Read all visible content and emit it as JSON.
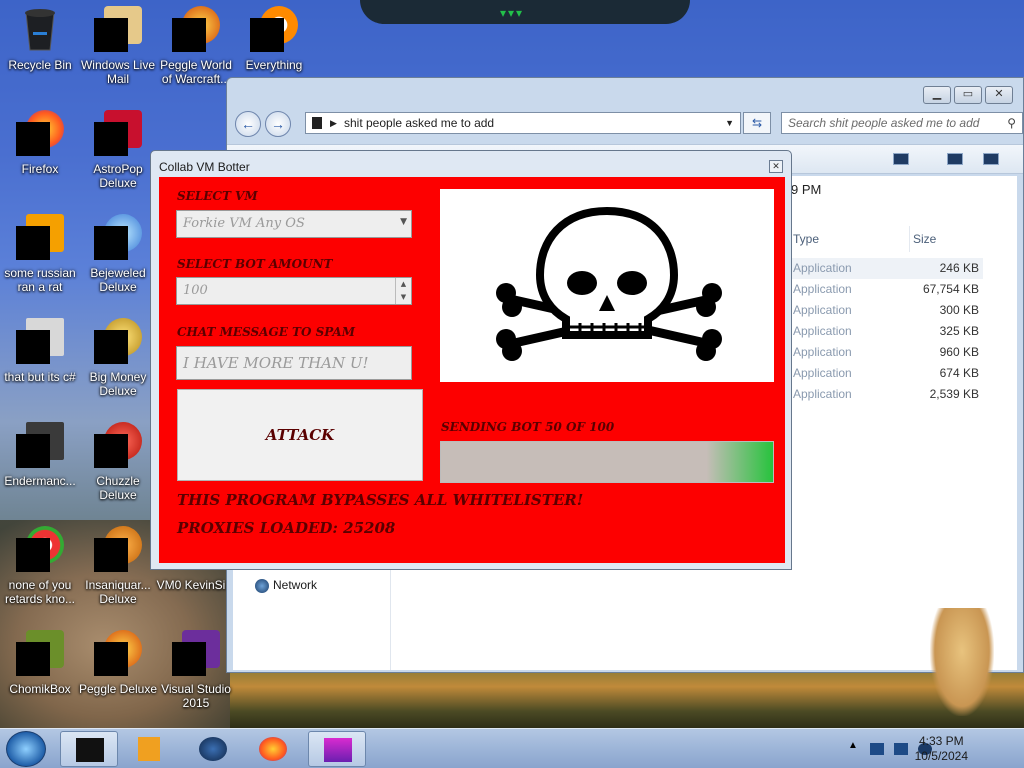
{
  "desktop": {
    "icons": [
      {
        "label": "Recycle Bin"
      },
      {
        "label": "Windows Live Mail"
      },
      {
        "label": "Peggle World of Warcraft..."
      },
      {
        "label": "Everything"
      },
      {
        "label": "Firefox"
      },
      {
        "label": "AstroPop Deluxe"
      },
      {
        "label": "some russian ran a rat"
      },
      {
        "label": "Bejeweled Deluxe"
      },
      {
        "label": "that but its c#"
      },
      {
        "label": "Big Money Deluxe"
      },
      {
        "label": "Endermanc..."
      },
      {
        "label": "Chuzzle Deluxe"
      },
      {
        "label": "none of you retards kno..."
      },
      {
        "label": "Insaniquar... Deluxe"
      },
      {
        "label": "VM0 KevinSi..."
      },
      {
        "label": "ChomikBox"
      },
      {
        "label": "Peggle Deluxe"
      },
      {
        "label": "Visual Studio 2015"
      }
    ]
  },
  "explorer": {
    "address": "shit people asked me to add",
    "search_placeholder": "Search shit people asked me to add",
    "partial_date": "9 PM",
    "columns": {
      "type": "Type",
      "size": "Size"
    },
    "files": [
      {
        "type": "Application",
        "size": "246 KB"
      },
      {
        "type": "Application",
        "size": "67,754 KB"
      },
      {
        "type": "Application",
        "size": "300 KB"
      },
      {
        "type": "Application",
        "size": "325 KB"
      },
      {
        "type": "Application",
        "size": "960 KB"
      },
      {
        "type": "Application",
        "size": "674 KB"
      },
      {
        "type": "Application",
        "size": "2,539 KB"
      }
    ],
    "nav": {
      "network": "Network"
    }
  },
  "botter": {
    "title": "Collab VM Botter",
    "select_vm_label": "SELECT VM",
    "select_vm_value": "Forkie VM Any OS",
    "bot_amount_label": "SELECT BOT AMOUNT",
    "bot_amount_value": "100",
    "chat_label": "CHAT MESSAGE TO SPAM",
    "chat_value": "I HAVE MORE THAN U!",
    "attack_label": "ATTACK",
    "progress_label": "SENDING BOT 50 OF 100",
    "progress_fraction": 0.5,
    "banner1": "THIS PROGRAM BYPASSES ALL WHITELISTER!",
    "banner2": "PROXIES LOADED: 25208",
    "colors": {
      "panel": "#fd0000",
      "text": "#5a0000",
      "progress_green": "#27c33d"
    }
  },
  "taskbar": {
    "time": "4:33 PM",
    "date": "10/5/2024"
  }
}
